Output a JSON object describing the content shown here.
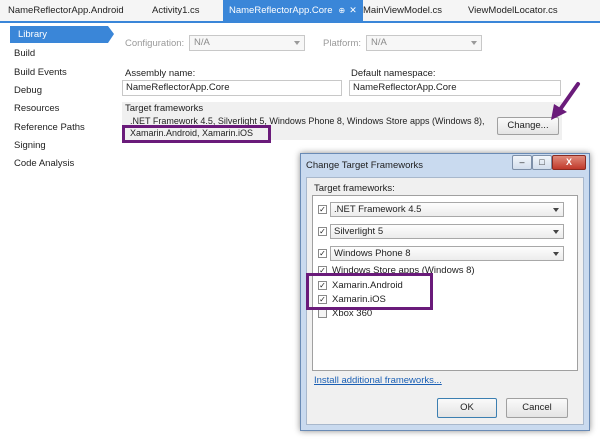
{
  "tabs": [
    {
      "label": "NameReflectorApp.Android"
    },
    {
      "label": "Activity1.cs"
    },
    {
      "label": "NameReflectorApp.Core",
      "pin": "⊕",
      "close": "✕"
    },
    {
      "label": "MainViewModel.cs"
    },
    {
      "label": "ViewModelLocator.cs"
    }
  ],
  "nav": [
    "Library",
    "Build",
    "Build Events",
    "Debug",
    "Resources",
    "Reference Paths",
    "Signing",
    "Code Analysis"
  ],
  "form": {
    "configuration_label": "Configuration:",
    "configuration_value": "N/A",
    "platform_label": "Platform:",
    "platform_value": "N/A",
    "assembly_label": "Assembly name:",
    "assembly_value": "NameReflectorApp.Core",
    "namespace_label": "Default namespace:",
    "namespace_value": "NameReflectorApp.Core",
    "target_label": "Target frameworks",
    "target_line1": ".NET Framework 4.5, Silverlight 5, Windows Phone 8, Windows Store apps (Windows 8),",
    "target_line2": "Xamarin.Android, Xamarin.iOS",
    "change_button": "Change..."
  },
  "dialog": {
    "title": "Change Target Frameworks",
    "minimize": "–",
    "maximize": "□",
    "close": "X",
    "list_label": "Target frameworks:",
    "items": [
      {
        "label": ".NET Framework 4.5",
        "checked": true,
        "type": "dropdown"
      },
      {
        "label": "Silverlight 5",
        "checked": true,
        "type": "dropdown"
      },
      {
        "label": "Windows Phone 8",
        "checked": true,
        "type": "dropdown"
      },
      {
        "label": "Windows Store apps (Windows 8)",
        "checked": true,
        "type": "text"
      },
      {
        "label": "Xamarin.Android",
        "checked": true,
        "type": "text"
      },
      {
        "label": "Xamarin.iOS",
        "checked": true,
        "type": "text"
      },
      {
        "label": "Xbox 360",
        "checked": false,
        "type": "text"
      }
    ],
    "install_link": "Install additional frameworks...",
    "ok": "OK",
    "cancel": "Cancel"
  },
  "colors": {
    "accent": "#3a86d8",
    "highlight": "#6a1b7a",
    "link": "#1a5fb4"
  }
}
